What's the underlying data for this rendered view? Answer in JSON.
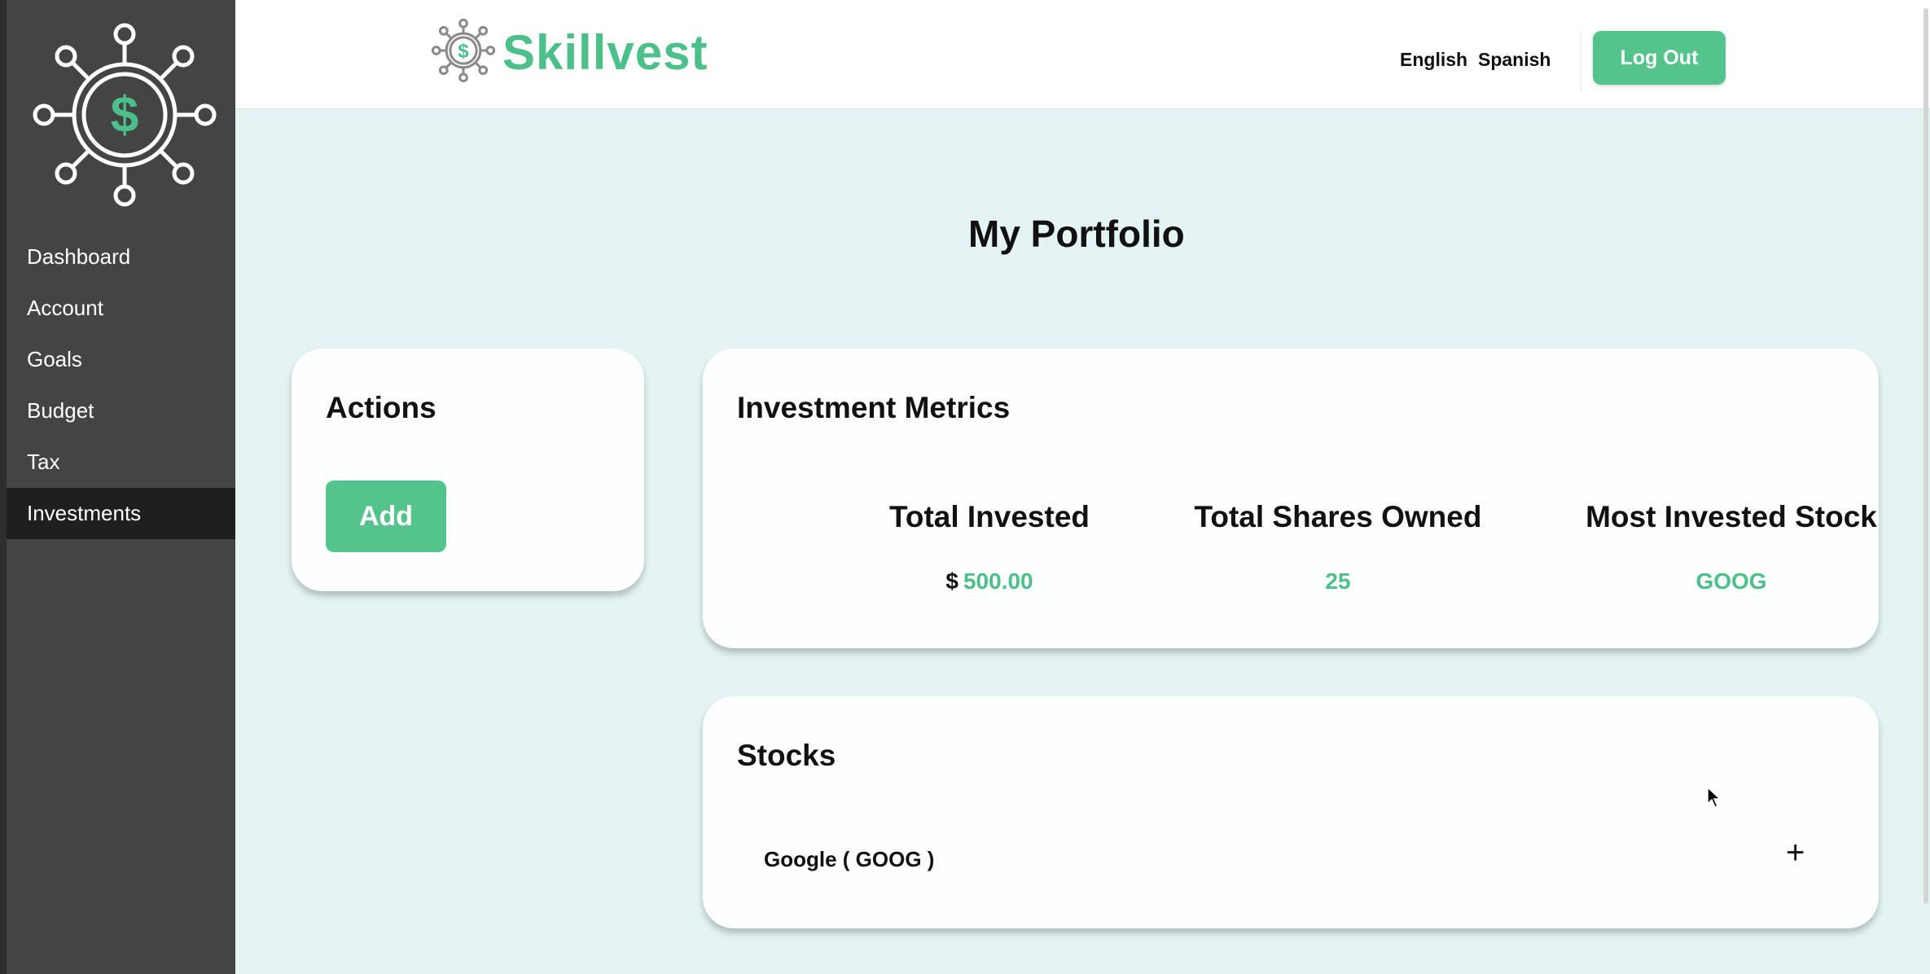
{
  "brand": {
    "name": "Skillvest",
    "accent": "#4dbf8a"
  },
  "sidebar": {
    "items": [
      {
        "label": "Dashboard"
      },
      {
        "label": "Account"
      },
      {
        "label": "Goals"
      },
      {
        "label": "Budget"
      },
      {
        "label": "Tax"
      },
      {
        "label": "Investments",
        "active": true
      }
    ]
  },
  "header": {
    "languages": [
      "English",
      "Spanish"
    ],
    "logout_label": "Log Out"
  },
  "page": {
    "title": "My Portfolio"
  },
  "actions": {
    "title": "Actions",
    "add_label": "Add"
  },
  "metrics": {
    "title": "Investment Metrics",
    "items": [
      {
        "label": "Total Invested",
        "currency": "$",
        "value": "500.00"
      },
      {
        "label": "Total Shares Owned",
        "value": "25"
      },
      {
        "label": "Most Invested Stock",
        "value": "GOOG"
      }
    ]
  },
  "stocks": {
    "title": "Stocks",
    "rows": [
      {
        "label": "Google ( GOOG )",
        "icon": "plus-icon"
      }
    ]
  }
}
